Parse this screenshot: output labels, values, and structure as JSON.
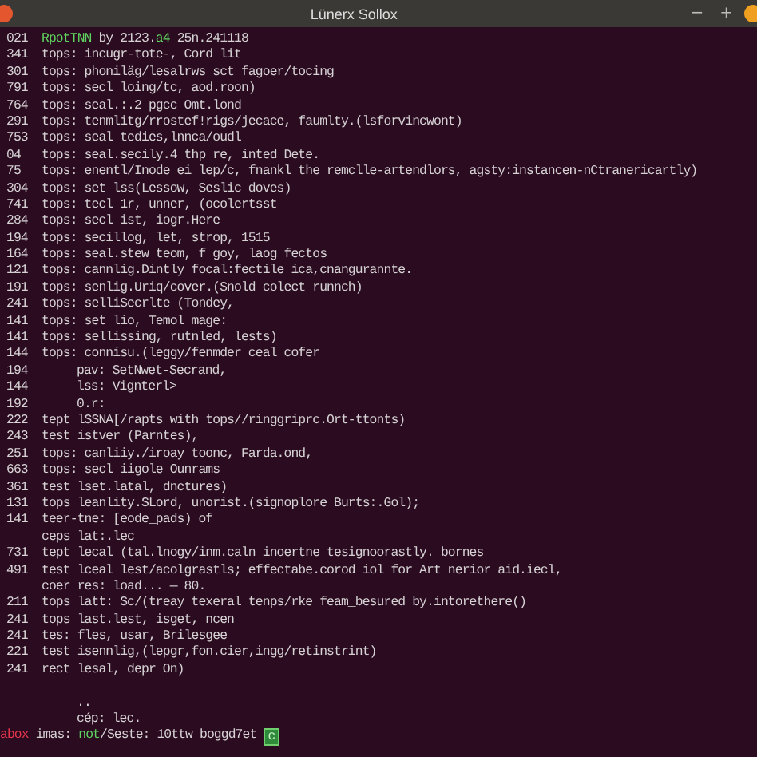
{
  "window": {
    "title": "Lünerx Sollox",
    "controls": [
      "−",
      "+"
    ]
  },
  "lines": [
    {
      "number": "021",
      "parts": [
        {
          "text": "RpotTNN",
          "color": "#5fd35f"
        },
        {
          "text": " by 2123."
        },
        {
          "text": "a4",
          "color": "#5fd35f"
        },
        {
          "text": " 25n.241118"
        }
      ]
    },
    {
      "number": "341",
      "text": "tops: incugr-tote-, Cord lit"
    },
    {
      "number": "301",
      "text": "tops: phoniläg/lesalrws sct fagoer/tocing"
    },
    {
      "number": "791",
      "text": "tops: secl loing/tc, aod.roon)"
    },
    {
      "number": "764",
      "text": "tops: seal.:.2 pgcc Omt.lond"
    },
    {
      "number": "291",
      "text": "tops: tenmlitg/rrostef!rigs/jecace, faumlty.(lsforvincwont)"
    },
    {
      "number": "753",
      "text": "tops: seal tedies,lnnca/oudl"
    },
    {
      "number": "04",
      "text": "tops: seal.secily.4 thp re, inted Dete."
    },
    {
      "number": "75",
      "text": "tops: enentl/Inode ei lep/c, fnankl the remclle-artendlors, agsty:instancen-nCtranericartly)"
    },
    {
      "number": "304",
      "text": "tops: set lss(Lessow, Seslic doves)"
    },
    {
      "number": "741",
      "text": "tops: tecl 1r, unner, (ocolertsst"
    },
    {
      "number": "284",
      "text": "tops: secl ist, iogr.Here"
    },
    {
      "number": "194",
      "text": "tops: secillog, let, strop, 1515"
    },
    {
      "number": "164",
      "text": "tops: seal.stew teom, f goy, laog fectos"
    },
    {
      "number": "121",
      "text": "tops: cannlig.Dintly focal:fectile ica,cnangurannte."
    },
    {
      "number": "191",
      "text": "tops: senlig.Uriq/cover.(Snold colect runnch)"
    },
    {
      "number": "241",
      "text": "tops: selliSecrlte (Tondey,"
    },
    {
      "number": "141",
      "text": "tops: set lio, Temol mage:"
    },
    {
      "number": "141",
      "text": "tops: sellissing, rutnled, lests)"
    },
    {
      "number": "144",
      "text": "tops: connisu.(leggy/fenmder ceal cofer"
    },
    {
      "number": "194",
      "kind": "nested",
      "text": "pav: SetNwet-Secrand,"
    },
    {
      "number": "144",
      "kind": "nested",
      "text": "lss: Vignterl>"
    },
    {
      "number": "192",
      "kind": "nested",
      "text": "0.r:"
    },
    {
      "number": "222",
      "text": "tept lSSNA[/rapts with tops//ringgriprc.Ort-ttonts)"
    },
    {
      "number": "243",
      "text": "test istver (Parntes),"
    },
    {
      "number": "251",
      "text": "tops: canliiy./iroay toonc, Farda.ond,"
    },
    {
      "number": "663",
      "text": "tops: secl iigole Ounrams"
    },
    {
      "number": "361",
      "text": "test lset.latal, dnctures)"
    },
    {
      "number": "131",
      "text": "tops leanlity.SLord, unorist.(signoplore Burts:.Gol);"
    },
    {
      "number": "141",
      "text": "teer-tne: [eode_pads) of"
    },
    {
      "text": "ceps lat:.lec"
    },
    {
      "number": "731",
      "text": "tept lecal (tal.lnogy/inm.caln inoertne_tesignoorastly. bornes"
    },
    {
      "number": "491",
      "text": "test lceal lest/acolgrastls; effectabe.corod iol for Art nerior aid.iecl,"
    },
    {
      "text": "coer res: load... — 80."
    },
    {
      "number": "211",
      "text": "tops latt: Sc/(treay texeral tenps/rke feam_besured by.intorethere()"
    },
    {
      "number": "241",
      "text": "tops last.lest, isget, ncen"
    },
    {
      "number": "241",
      "text": "tes: fles, usar, Brilesgee"
    },
    {
      "number": "221",
      "text": "test isennlig,(lepgr,fon.cier,ingg/retinstrint)"
    },
    {
      "number": "241",
      "text": "rect lesal, depr On)"
    },
    {
      "kind": "blank"
    },
    {
      "kind": "nested",
      "text": ".."
    },
    {
      "kind": "nested",
      "text": "cép: lec."
    }
  ],
  "prompt": {
    "parts": [
      {
        "text": "abox",
        "color": "#e8364a"
      },
      {
        "text": " imas: "
      },
      {
        "text": "not",
        "color": "#5fd35f"
      },
      {
        "text": "/Seste: 10ttw_boggd7et"
      }
    ],
    "cursor": "c"
  }
}
